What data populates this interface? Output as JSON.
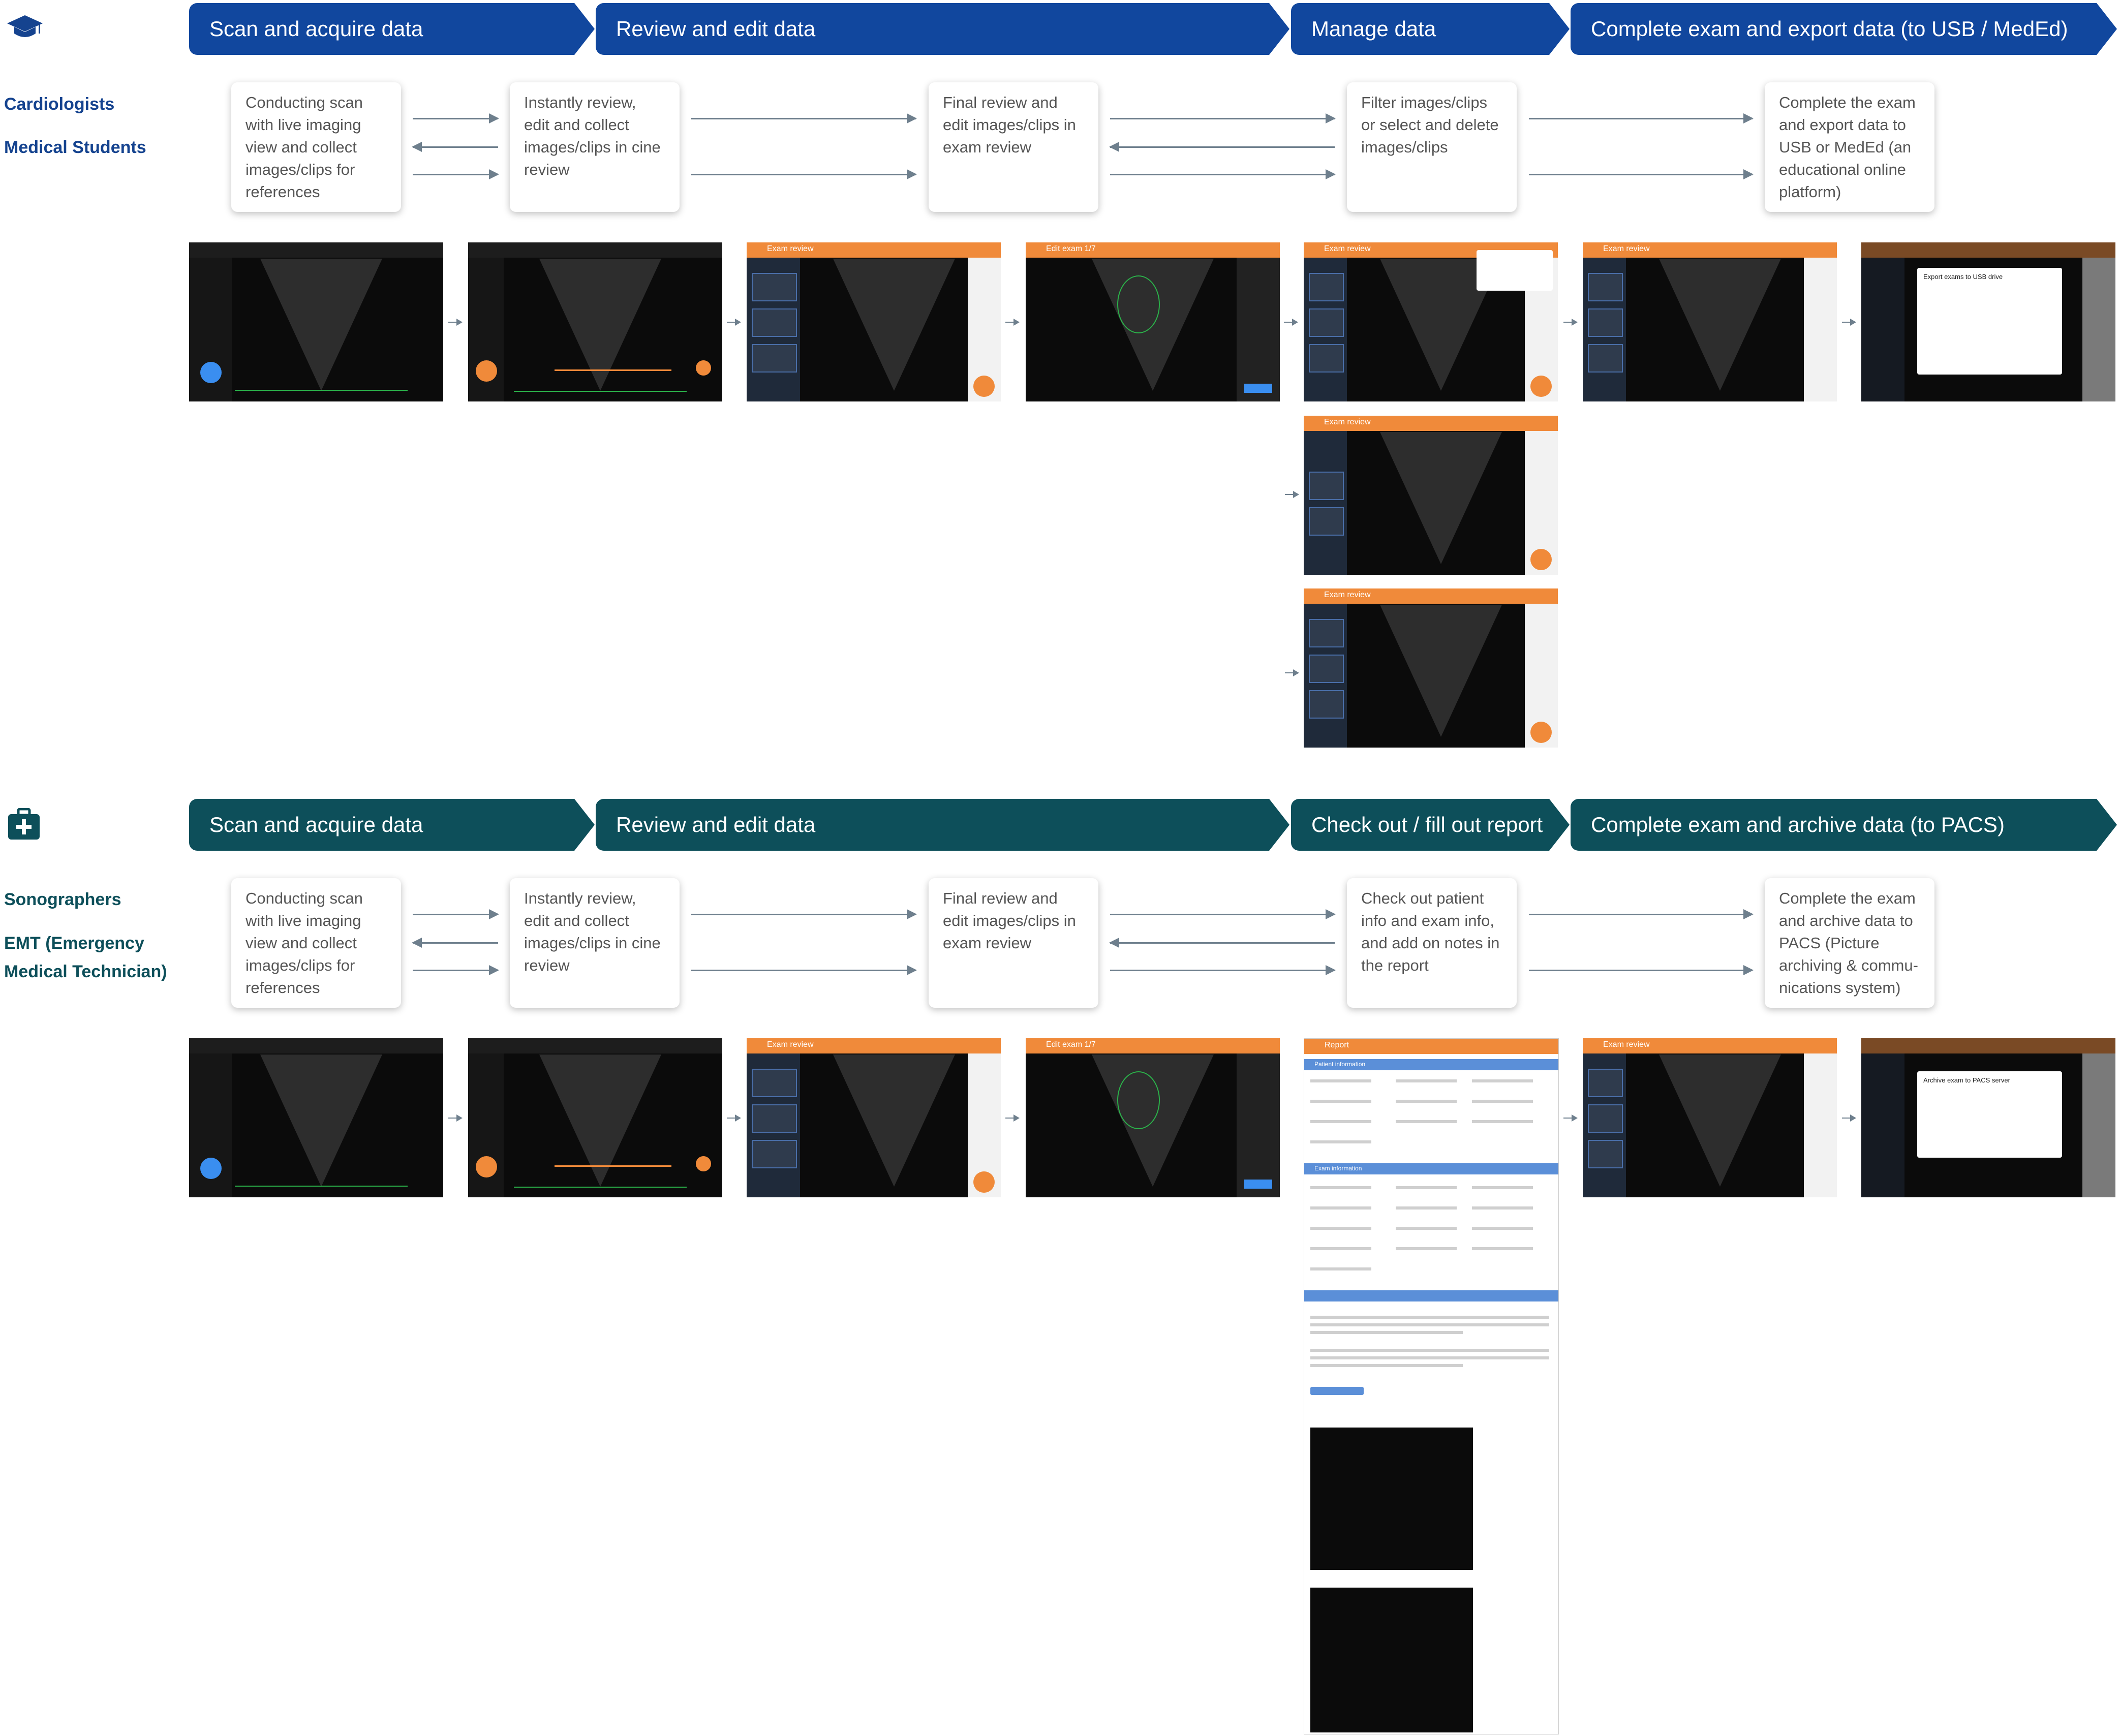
{
  "flow_a": {
    "stages": [
      "Scan and acquire data",
      "Review and edit data",
      "Manage data",
      "Complete exam and export data (to USB / MedEd)"
    ],
    "personas": [
      "Cardiologists",
      "Medical Students"
    ],
    "steps": [
      "Conducting scan with live imaging view and collect images/clips for references",
      "Instantly review, edit and collect images/clips in cine review",
      "Final review and edit images/clips in exam review",
      "Filter images/clips or select and delete images/clips",
      "Complete the exam and export data to USB or MedEd (an educational online platform)"
    ]
  },
  "flow_b": {
    "stages": [
      "Scan and acquire data",
      "Review and edit data",
      "Check out / fill out report",
      "Complete exam and archive data (to PACS)"
    ],
    "personas": [
      "Sonographers",
      "EMT (Emergency Medical Technician)"
    ],
    "steps": [
      "Conducting scan with live imaging view and collect images/clips for references",
      "Instantly review, edit and collect images/clips in cine review",
      "Final review and edit images/clips in exam review",
      "Check out patient info and exam info, and add on notes in the report",
      "Complete the exam and archive data to PACS (Picture archiving & commu-nications system)"
    ]
  },
  "screens": {
    "exam_review": "Exam review",
    "edit_exam": "Edit exam 1/7",
    "report": "Report",
    "patient_info": "Patient information",
    "exam_info": "Exam information",
    "export_dialog": "Export exams to USB drive",
    "archive_dialog": "Archive exam to PACS server"
  },
  "colors": {
    "blue": "#11479e",
    "teal": "#0d4f5a",
    "orange": "#f08a3a"
  },
  "icons": {
    "flow_a": "graduation-cap-icon",
    "flow_b": "medical-kit-icon"
  }
}
